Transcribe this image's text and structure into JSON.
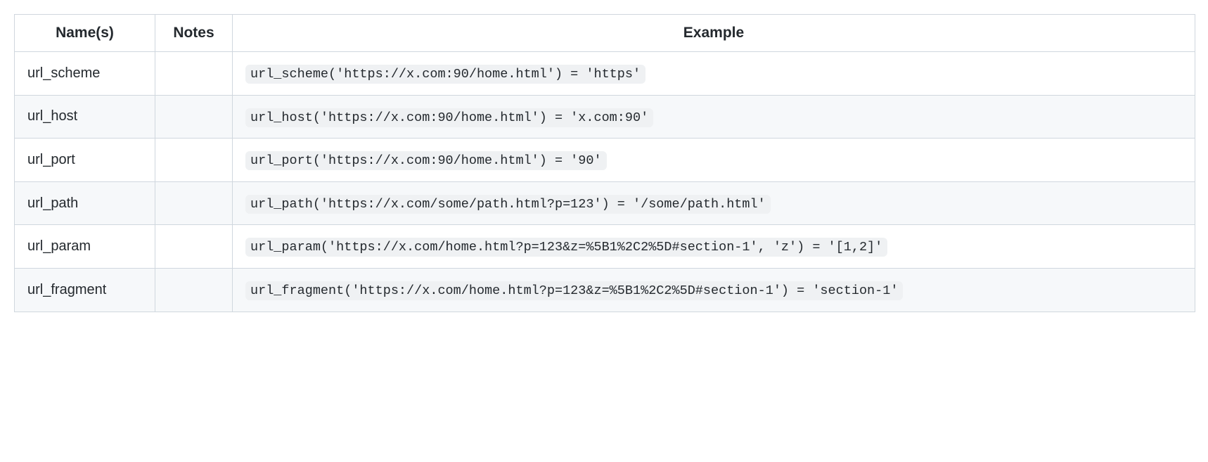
{
  "headers": {
    "name": "Name(s)",
    "notes": "Notes",
    "example": "Example"
  },
  "rows": [
    {
      "name": "url_scheme",
      "notes": "",
      "example": "url_scheme('https://x.com:90/home.html') = 'https'"
    },
    {
      "name": "url_host",
      "notes": "",
      "example": "url_host('https://x.com:90/home.html') = 'x.com:90'"
    },
    {
      "name": "url_port",
      "notes": "",
      "example": "url_port('https://x.com:90/home.html') = '90'"
    },
    {
      "name": "url_path",
      "notes": "",
      "example": "url_path('https://x.com/some/path.html?p=123') = '/some/path.html'"
    },
    {
      "name": "url_param",
      "notes": "",
      "example": "url_param('https://x.com/home.html?p=123&z=%5B1%2C2%5D#section-1', 'z') = '[1,2]'"
    },
    {
      "name": "url_fragment",
      "notes": "",
      "example": "url_fragment('https://x.com/home.html?p=123&z=%5B1%2C2%5D#section-1') = 'section-1'"
    }
  ]
}
